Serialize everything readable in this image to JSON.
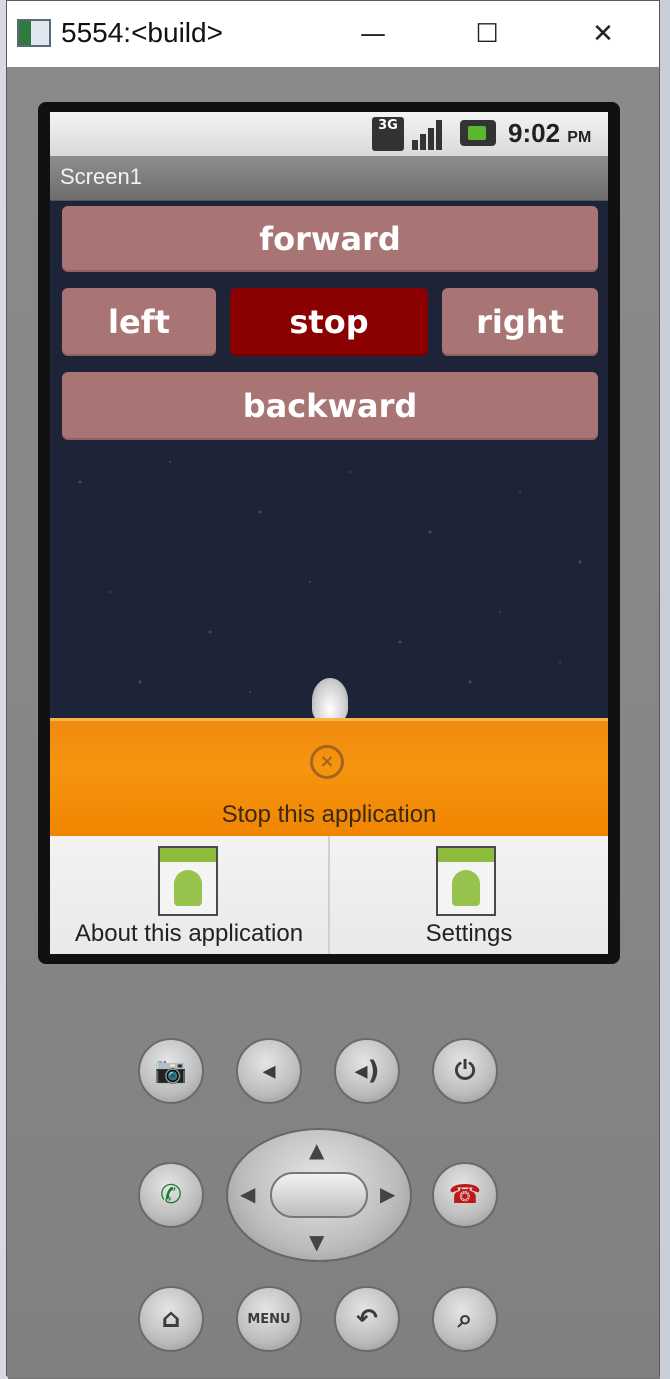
{
  "window": {
    "title": "5554:<build>",
    "controls": {
      "minimize": "—",
      "maximize": "☐",
      "close": "✕"
    }
  },
  "status_bar": {
    "network": "3G",
    "time": "9:02",
    "ampm": "PM"
  },
  "app": {
    "title": "Screen1",
    "buttons": {
      "forward": "forward",
      "left": "left",
      "stop": "stop",
      "right": "right",
      "backward": "backward"
    }
  },
  "overlay_menu": {
    "stop_label": "Stop this application",
    "about_label": "About this application",
    "settings_label": "Settings"
  },
  "hardware_keys": {
    "menu": "MENU",
    "icons": [
      "camera-icon",
      "volume-down-icon",
      "volume-up-icon",
      "power-icon",
      "call-icon",
      "end-call-icon",
      "home-icon",
      "back-icon",
      "search-icon"
    ]
  },
  "colors": {
    "button": "#a87574",
    "stop_button": "#8b0000",
    "menu_orange": "#f6950f",
    "screen_bg": "#1e2437"
  }
}
